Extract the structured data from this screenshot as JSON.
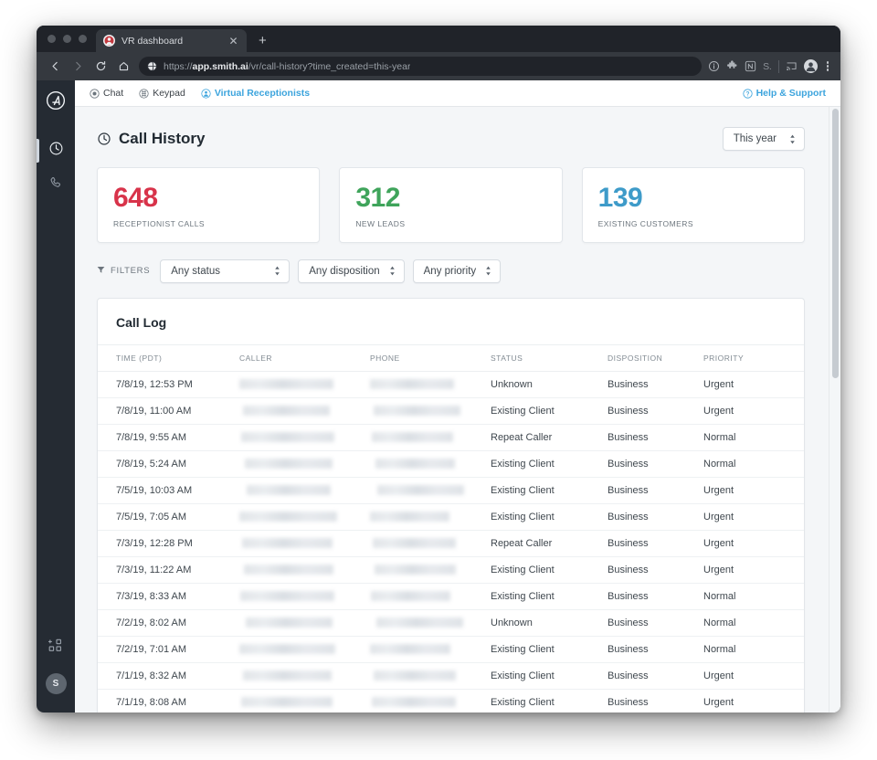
{
  "browser": {
    "tab": {
      "title": "VR dashboard",
      "favicon_icon": "smith-ai-favicon",
      "close_icon": "close-icon"
    },
    "new_tab_icon": "plus-icon",
    "nav": {
      "back_icon": "arrow-left-icon",
      "forward_icon": "arrow-right-icon",
      "reload_icon": "reload-icon",
      "home_icon": "home-icon"
    },
    "omnibox": {
      "site_icon": "globe-icon",
      "scheme": "https://",
      "host": "app.smith.ai",
      "path": "/vr/call-history?time_created=this-year",
      "full_url": "https://app.smith.ai/vr/call-history?time_created=this-year"
    },
    "extensions": [
      {
        "name": "info-icon",
        "label": ""
      },
      {
        "name": "puzzle-piece-icon",
        "label": ""
      },
      {
        "name": "notion-extension-icon",
        "label": "N"
      },
      {
        "name": "s-extension-icon",
        "label": "S."
      },
      {
        "name": "cast-icon",
        "label": ""
      },
      {
        "name": "profile-avatar-icon",
        "label": ""
      },
      {
        "name": "chrome-menu-icon",
        "label": ""
      }
    ]
  },
  "rail": {
    "logo_icon": "smith-ai-logo",
    "items": [
      {
        "icon": "clock-icon",
        "name": "call-history",
        "active": true
      },
      {
        "icon": "phone-icon",
        "name": "calls",
        "active": false
      }
    ],
    "bottom": {
      "add_app_icon": "add-apps-grid-icon",
      "avatar_initial": "S"
    }
  },
  "appnav": {
    "links": [
      {
        "label": "Chat",
        "icon": "chat-bubble-icon",
        "active": false
      },
      {
        "label": "Keypad",
        "icon": "keypad-grid-icon",
        "active": false
      },
      {
        "label": "Virtual Receptionists",
        "icon": "receptionist-icon",
        "active": true
      }
    ],
    "help": {
      "label": "Help & Support",
      "icon": "question-circle-icon"
    }
  },
  "page": {
    "title": "Call History",
    "title_icon": "clock-icon",
    "range_filter": {
      "value": "This year",
      "caret_icon": "up-down-caret-icon"
    }
  },
  "stats": [
    {
      "value": "648",
      "label": "Receptionist Calls",
      "color": "#D8334A"
    },
    {
      "value": "312",
      "label": "New Leads",
      "color": "#3FA45B"
    },
    {
      "value": "139",
      "label": "Existing Customers",
      "color": "#3E9BC9"
    }
  ],
  "filters": {
    "label": "Filters",
    "icon": "funnel-icon",
    "selects": [
      {
        "name": "status-filter",
        "value": "Any status"
      },
      {
        "name": "disposition-filter",
        "value": "Any disposition"
      },
      {
        "name": "priority-filter",
        "value": "Any priority"
      }
    ]
  },
  "call_log": {
    "title": "Call Log",
    "columns": [
      "Time (PDT)",
      "Caller",
      "Phone",
      "Status",
      "Disposition",
      "Priority"
    ],
    "rows": [
      {
        "time": "7/8/19, 12:53 PM",
        "caller": "",
        "phone": "",
        "status": "Unknown",
        "disposition": "Business",
        "priority": "Urgent"
      },
      {
        "time": "7/8/19, 11:00 AM",
        "caller": "",
        "phone": "",
        "status": "Existing Client",
        "disposition": "Business",
        "priority": "Urgent"
      },
      {
        "time": "7/8/19, 9:55 AM",
        "caller": "",
        "phone": "",
        "status": "Repeat Caller",
        "disposition": "Business",
        "priority": "Normal"
      },
      {
        "time": "7/8/19, 5:24 AM",
        "caller": "",
        "phone": "",
        "status": "Existing Client",
        "disposition": "Business",
        "priority": "Normal"
      },
      {
        "time": "7/5/19, 10:03 AM",
        "caller": "",
        "phone": "",
        "status": "Existing Client",
        "disposition": "Business",
        "priority": "Urgent"
      },
      {
        "time": "7/5/19, 7:05 AM",
        "caller": "",
        "phone": "",
        "status": "Existing Client",
        "disposition": "Business",
        "priority": "Urgent"
      },
      {
        "time": "7/3/19, 12:28 PM",
        "caller": "",
        "phone": "",
        "status": "Repeat Caller",
        "disposition": "Business",
        "priority": "Urgent"
      },
      {
        "time": "7/3/19, 11:22 AM",
        "caller": "",
        "phone": "",
        "status": "Existing Client",
        "disposition": "Business",
        "priority": "Urgent"
      },
      {
        "time": "7/3/19, 8:33 AM",
        "caller": "",
        "phone": "",
        "status": "Existing Client",
        "disposition": "Business",
        "priority": "Normal"
      },
      {
        "time": "7/2/19, 8:02 AM",
        "caller": "",
        "phone": "",
        "status": "Unknown",
        "disposition": "Business",
        "priority": "Normal"
      },
      {
        "time": "7/2/19, 7:01 AM",
        "caller": "",
        "phone": "",
        "status": "Existing Client",
        "disposition": "Business",
        "priority": "Normal"
      },
      {
        "time": "7/1/19, 8:32 AM",
        "caller": "",
        "phone": "",
        "status": "Existing Client",
        "disposition": "Business",
        "priority": "Urgent"
      },
      {
        "time": "7/1/19, 8:08 AM",
        "caller": "",
        "phone": "",
        "status": "Existing Client",
        "disposition": "Business",
        "priority": "Urgent"
      }
    ]
  }
}
